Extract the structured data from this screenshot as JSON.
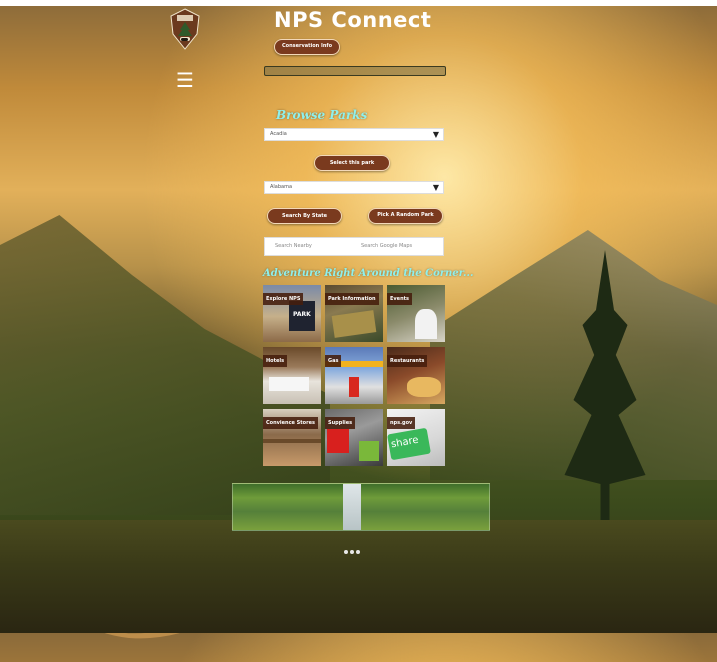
{
  "header": {
    "title": "NPS Connect",
    "conservation_label": "Conservation Info",
    "menu_icon": "☰"
  },
  "browse": {
    "heading": "Browse Parks",
    "park_select": "Acadia",
    "select_button": "Select this park",
    "state_select": "Alabama",
    "search_state_button": "Search By State",
    "random_button": "Pick A Random Park",
    "search_nearby_placeholder": "Search Nearby",
    "search_maps_placeholder": "Search Google Maps"
  },
  "adventure": {
    "heading": "Adventure Right Around the Corner...",
    "tiles": [
      {
        "label": "Explore NPS",
        "img": "PARK"
      },
      {
        "label": "Park Information",
        "img": ""
      },
      {
        "label": "Events",
        "img": ""
      },
      {
        "label": "Hotels",
        "img": ""
      },
      {
        "label": "Gas",
        "img": ""
      },
      {
        "label": "Restaurants",
        "img": ""
      },
      {
        "label": "Convience Stores",
        "img": ""
      },
      {
        "label": "Supplies",
        "img": ""
      },
      {
        "label": "nps.gov",
        "img": "share"
      }
    ]
  },
  "colors": {
    "accent_brown": "#7a3a1e",
    "heading_cyan": "#8ff0ec"
  },
  "slideshow": {
    "dots": 3,
    "active": 0
  }
}
